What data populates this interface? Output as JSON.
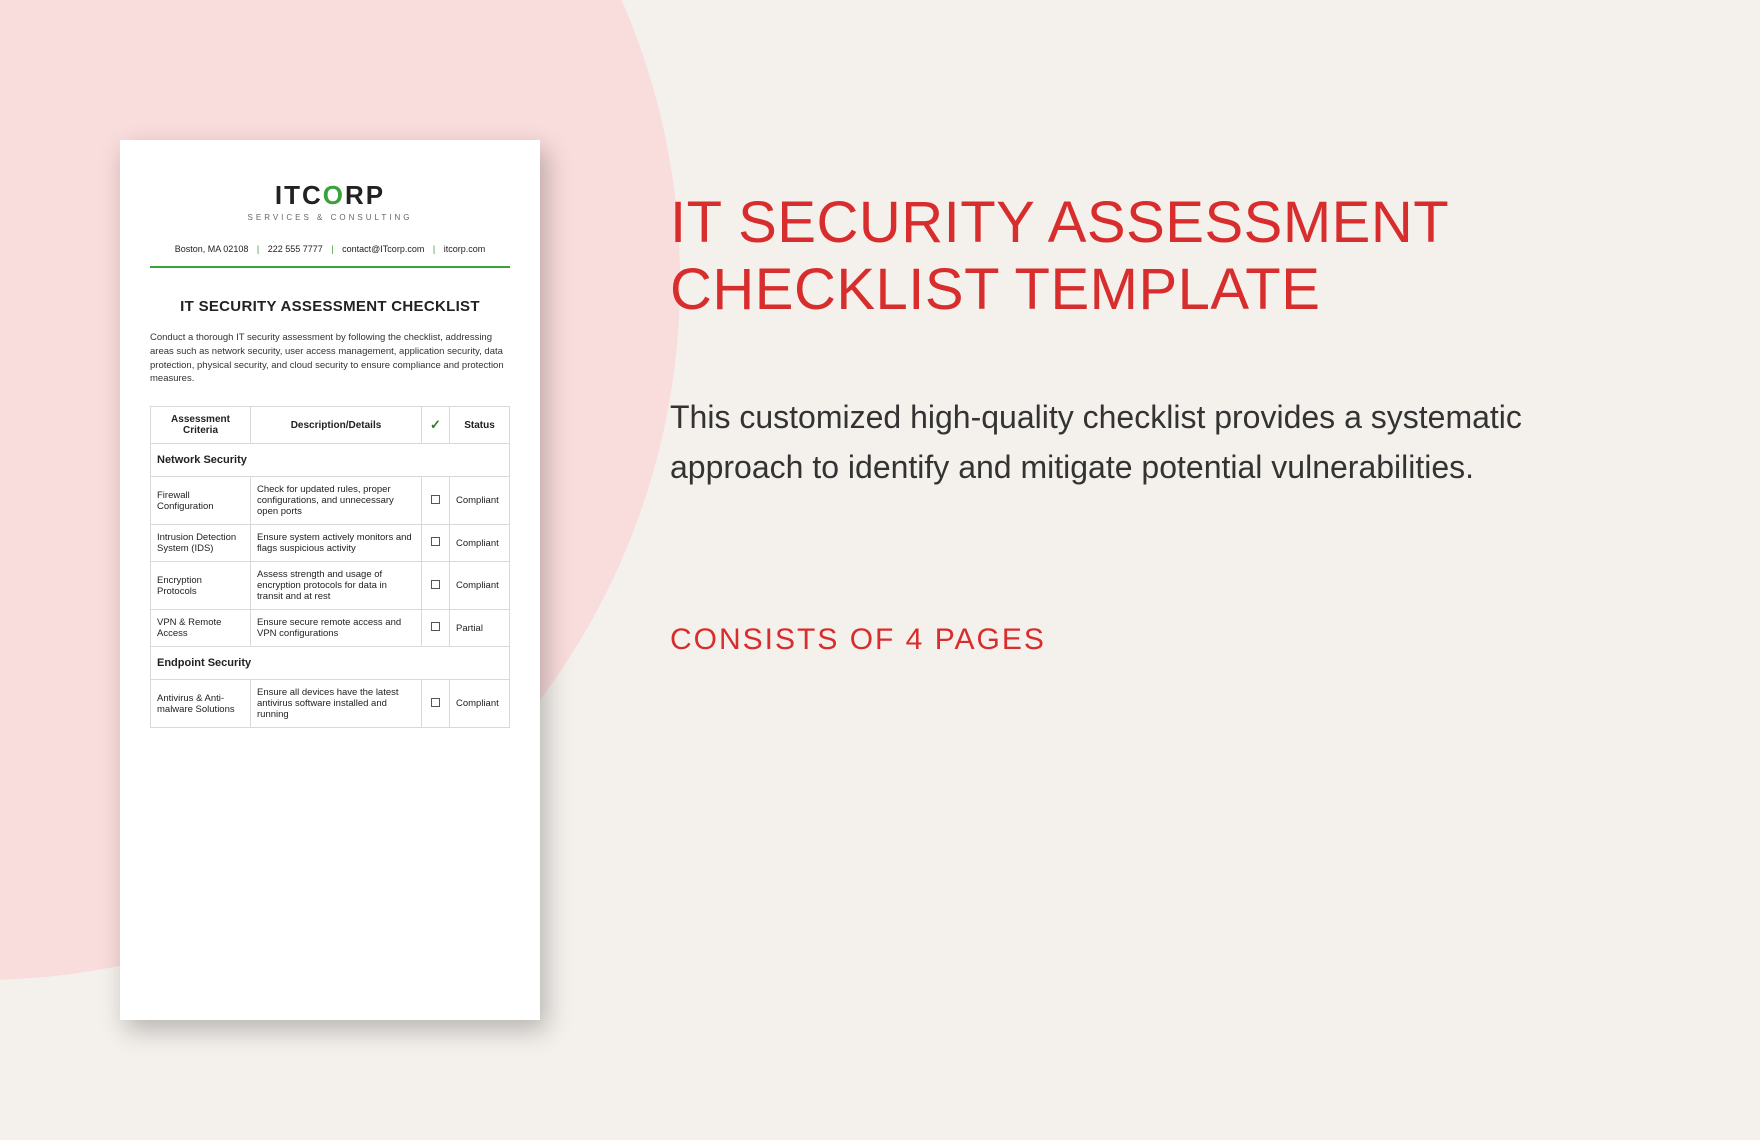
{
  "document": {
    "logo": {
      "text_it": "IT",
      "text_c": "C",
      "text_o": "O",
      "text_rp": "RP",
      "sub": "SERVICES & CONSULTING"
    },
    "contact": {
      "city": "Boston, MA 02108",
      "phone": "222 555 7777",
      "email": "contact@ITcorp.com",
      "site": "itcorp.com"
    },
    "title": "IT SECURITY ASSESSMENT CHECKLIST",
    "intro": "Conduct a thorough IT security assessment by following the checklist, addressing areas such as network security, user access management, application security, data protection, physical security, and cloud security to ensure compliance and protection measures.",
    "headers": {
      "criteria": "Assessment Criteria",
      "desc": "Description/Details",
      "status": "Status"
    },
    "sections": [
      {
        "name": "Network Security",
        "rows": [
          {
            "criteria": "Firewall Configuration",
            "desc": "Check for updated rules, proper configurations, and unnecessary open ports",
            "status": "Compliant"
          },
          {
            "criteria": "Intrusion Detection System (IDS)",
            "desc": "Ensure system actively monitors and flags suspicious activity",
            "status": "Compliant"
          },
          {
            "criteria": "Encryption Protocols",
            "desc": "Assess strength and usage of encryption protocols for data in transit and at rest",
            "status": "Compliant"
          },
          {
            "criteria": "VPN & Remote Access",
            "desc": "Ensure secure remote access and VPN configurations",
            "status": "Partial"
          }
        ]
      },
      {
        "name": "Endpoint Security",
        "rows": [
          {
            "criteria": "Antivirus & Anti-malware Solutions",
            "desc": "Ensure all devices have the latest antivirus software installed and running",
            "status": "Compliant"
          }
        ]
      }
    ]
  },
  "promo": {
    "headline": "IT SECURITY ASSESSMENT CHECKLIST TEMPLATE",
    "subcopy": "This customized high-quality checklist provides a systematic approach to identify and mitigate potential vulnerabilities.",
    "pages": "CONSISTS OF 4 PAGES"
  }
}
